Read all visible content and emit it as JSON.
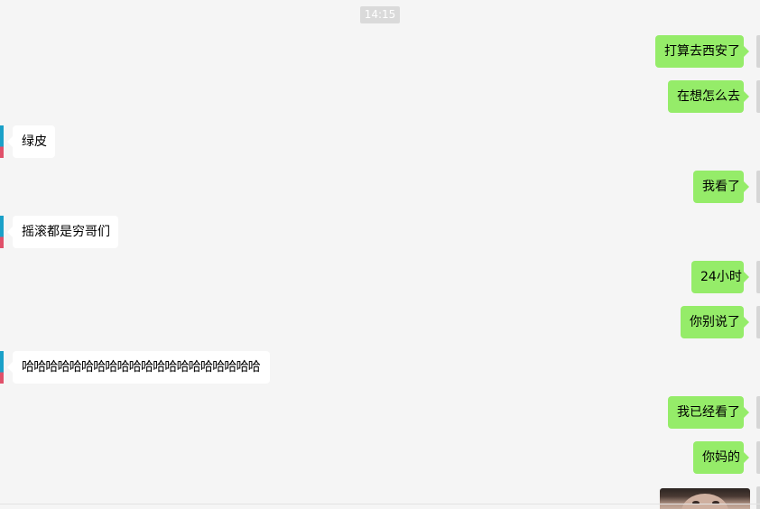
{
  "chat": {
    "timestamp": "14:15",
    "messages": [
      {
        "side": "out",
        "text": "打算去西安了"
      },
      {
        "side": "out",
        "text": "在想怎么去"
      },
      {
        "side": "in",
        "text": "绿皮"
      },
      {
        "side": "out",
        "text": "我看了"
      },
      {
        "side": "in",
        "text": "摇滚都是穷哥们"
      },
      {
        "side": "out",
        "text": "24小时"
      },
      {
        "side": "out",
        "text": "你别说了"
      },
      {
        "side": "in",
        "text": "哈哈哈哈哈哈哈哈哈哈哈哈哈哈哈哈哈哈哈哈"
      },
      {
        "side": "out",
        "text": "我已经看了"
      },
      {
        "side": "out",
        "text": "你妈的"
      },
      {
        "side": "out",
        "type": "image",
        "description_icon": "photo-thumbnail-icon"
      }
    ]
  },
  "colors": {
    "background": "#f5f5f5",
    "outgoing_bubble": "#95ec69",
    "incoming_bubble": "#ffffff",
    "timestamp_bg": "#dadada"
  }
}
